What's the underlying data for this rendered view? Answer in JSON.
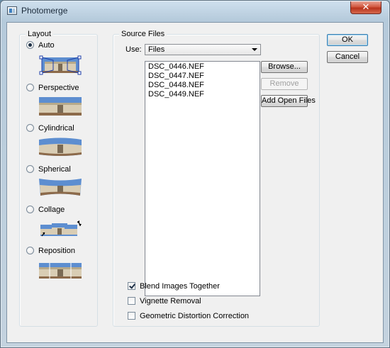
{
  "window": {
    "title": "Photomerge",
    "close_glyph": "✕"
  },
  "layout": {
    "legend": "Layout",
    "options": [
      {
        "label": "Auto",
        "selected": true,
        "icon": "auto-layout-icon"
      },
      {
        "label": "Perspective",
        "selected": false,
        "icon": "perspective-layout-icon"
      },
      {
        "label": "Cylindrical",
        "selected": false,
        "icon": "cylindrical-layout-icon"
      },
      {
        "label": "Spherical",
        "selected": false,
        "icon": "spherical-layout-icon"
      },
      {
        "label": "Collage",
        "selected": false,
        "icon": "collage-layout-icon"
      },
      {
        "label": "Reposition",
        "selected": false,
        "icon": "reposition-layout-icon"
      }
    ]
  },
  "source": {
    "legend": "Source Files",
    "use_label": "Use:",
    "use_value": "Files",
    "files": [
      "DSC_0446.NEF",
      "DSC_0447.NEF",
      "DSC_0448.NEF",
      "DSC_0449.NEF"
    ],
    "browse_label": "Browse...",
    "remove_label": "Remove",
    "add_open_label": "Add Open Files"
  },
  "options": {
    "blend": {
      "label": "Blend Images Together",
      "checked": true
    },
    "vignette": {
      "label": "Vignette Removal",
      "checked": false
    },
    "distortion": {
      "label": "Geometric Distortion Correction",
      "checked": false
    }
  },
  "buttons": {
    "ok": "OK",
    "cancel": "Cancel"
  },
  "colors": {
    "sky": "#5d8ed0",
    "building": "#d9cdb4",
    "roof": "#b7a98a",
    "ground": "#8c6a4a",
    "accent": "#3c7fb1"
  }
}
